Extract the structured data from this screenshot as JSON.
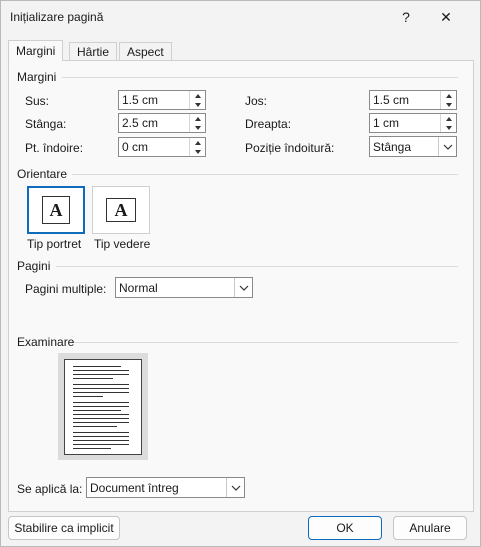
{
  "window": {
    "title": "Inițializare pagină",
    "help_glyph": "?",
    "close_glyph": "✕"
  },
  "tabs": [
    {
      "label": "Margini",
      "active": true
    },
    {
      "label": "Hârtie",
      "active": false
    },
    {
      "label": "Aspect",
      "active": false
    }
  ],
  "margins": {
    "group_label": "Margini",
    "top": {
      "label": "Sus:",
      "value": "1.5 cm"
    },
    "left": {
      "label": "Stânga:",
      "value": "2.5 cm"
    },
    "gutter": {
      "label": "Pt. îndoire:",
      "value": "0 cm"
    },
    "bottom": {
      "label": "Jos:",
      "value": "1.5 cm"
    },
    "right": {
      "label": "Dreapta:",
      "value": "1 cm"
    },
    "gutter_position": {
      "label": "Poziție îndoitură:",
      "value": "Stânga"
    }
  },
  "orientation": {
    "group_label": "Orientare",
    "icon_letter": "A",
    "portrait": {
      "label": "Tip portret",
      "selected": true
    },
    "landscape": {
      "label": "Tip vedere",
      "selected": false
    }
  },
  "pages": {
    "group_label": "Pagini",
    "multiple_label": "Pagini multiple:",
    "multiple_value": "Normal"
  },
  "preview": {
    "group_label": "Examinare"
  },
  "apply": {
    "label": "Se aplică la:",
    "value": "Document întreg"
  },
  "buttons": {
    "set_default": "Stabilire ca implicit",
    "ok": "OK",
    "cancel": "Anulare"
  },
  "colors": {
    "accent": "#0f6cbd"
  }
}
